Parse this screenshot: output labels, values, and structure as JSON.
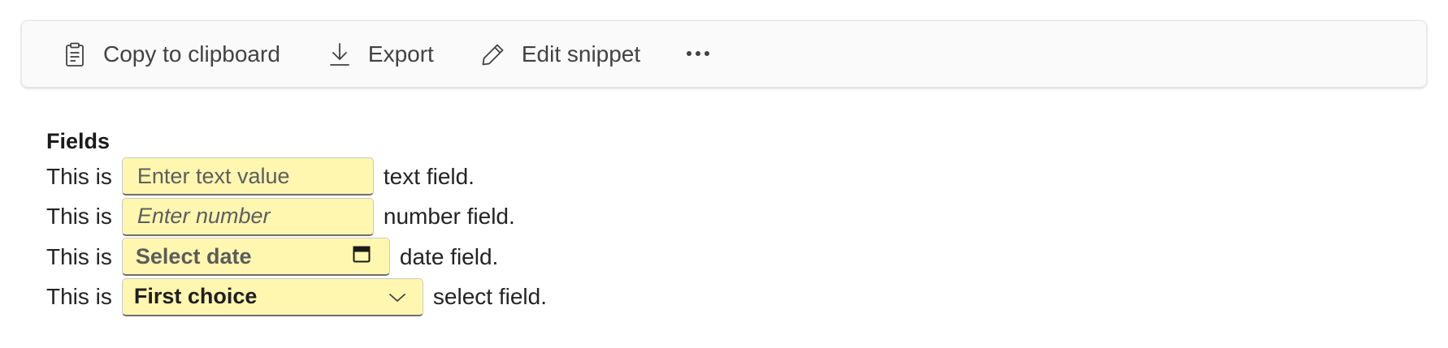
{
  "toolbar": {
    "copy_label": "Copy to clipboard",
    "export_label": "Export",
    "edit_label": "Edit snippet",
    "more_icon": "more-horizontal-icon"
  },
  "fields": {
    "heading": "Fields",
    "prefix": "This is",
    "text_field": {
      "placeholder": "Enter text value",
      "suffix": "text field."
    },
    "number_field": {
      "placeholder": "Enter number",
      "suffix": "number field."
    },
    "date_field": {
      "placeholder": "Select date",
      "suffix": "date field."
    },
    "select_field": {
      "value": "First choice",
      "suffix": "select field."
    }
  },
  "colors": {
    "field_background": "#fff7b0",
    "toolbar_background": "#fafafa"
  }
}
